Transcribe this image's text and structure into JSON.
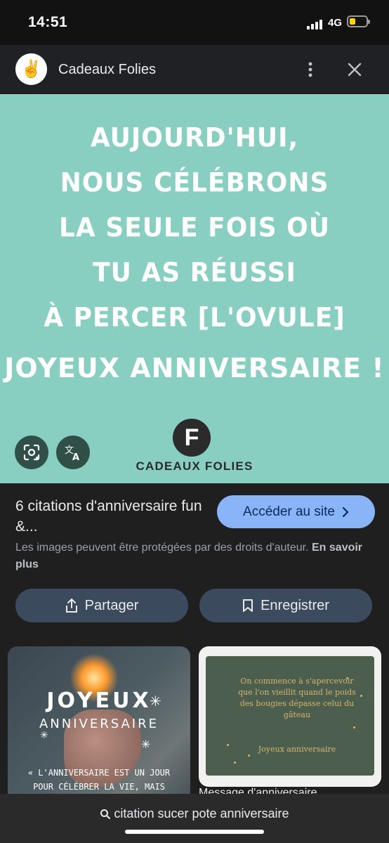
{
  "status_bar": {
    "time": "14:51",
    "network": "4G"
  },
  "header": {
    "site_name": "Cadeaux Folies",
    "logo_emoji": "✌️"
  },
  "image": {
    "quote": "AUJOURD'HUI,\nNOUS CÉLÉBRONS\nLA SEULE FOIS OÙ\nTU AS RÉUSSI\nÀ PERCER [L'OVULE]",
    "headline": "JOYEUX ANNIVERSAIRE !",
    "brand_letter": "F",
    "brand_name": "CADEAUX FOLIES",
    "bg_color": "#88cfc1"
  },
  "info": {
    "title": "6 citations d'anniversaire fun &...",
    "visit_label": "Accéder au site",
    "copyright_text": "Les images peuvent être protégées par des droits d'auteur.",
    "learn_more": "En savoir plus",
    "share_label": "Partager",
    "save_label": "Enregistrer"
  },
  "related": [
    {
      "title": "JOYEUX",
      "subtitle": "ANNIVERSAIRE",
      "quote": "« L'ANNIVERSAIRE EST UN JOUR\nPOUR CÉLÉBRER LA VIE, MAIS"
    },
    {
      "quote": "On commence à s'apercevoir\nque l'on vieillit quand le poids\ndes bougies dépasse celui du\ngâteau",
      "wish": "Joyeux anniversaire",
      "caption": "Message d'anniversaire"
    }
  ],
  "search": {
    "query": "citation sucer pote anniversaire"
  }
}
